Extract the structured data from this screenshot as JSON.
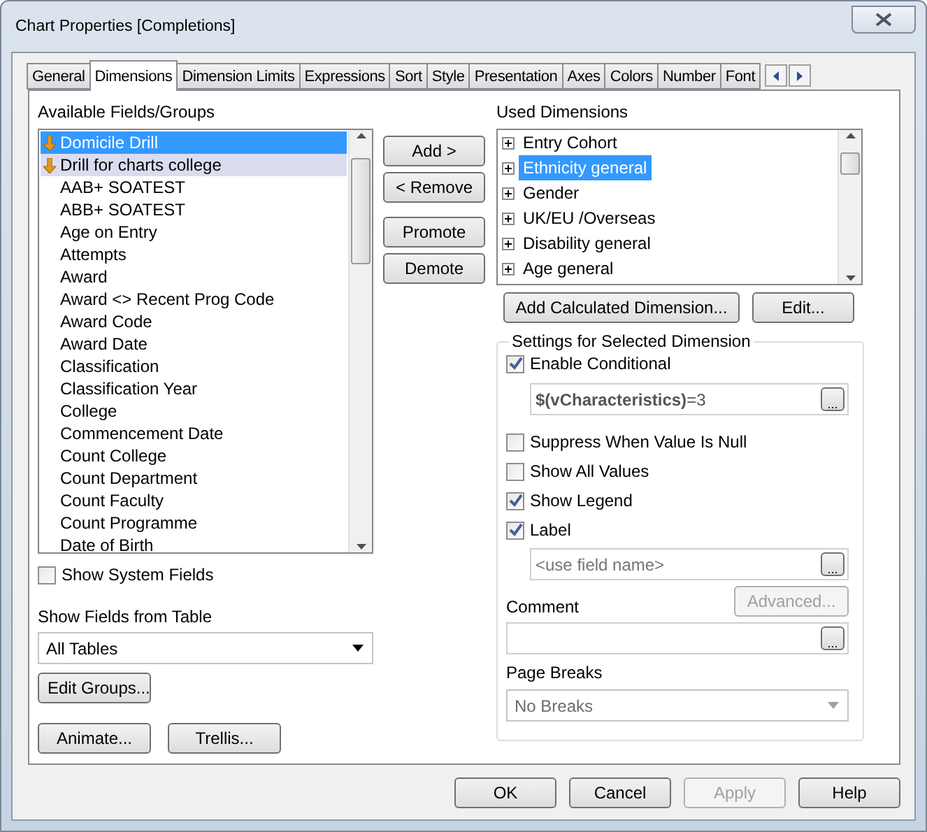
{
  "window": {
    "title": "Chart Properties [Completions]"
  },
  "tabs": [
    {
      "label": "General",
      "selected": false
    },
    {
      "label": "Dimensions",
      "selected": true
    },
    {
      "label": "Dimension Limits",
      "selected": false
    },
    {
      "label": "Expressions",
      "selected": false
    },
    {
      "label": "Sort",
      "selected": false
    },
    {
      "label": "Style",
      "selected": false
    },
    {
      "label": "Presentation",
      "selected": false
    },
    {
      "label": "Axes",
      "selected": false
    },
    {
      "label": "Colors",
      "selected": false
    },
    {
      "label": "Number",
      "selected": false
    },
    {
      "label": "Font",
      "selected": false
    }
  ],
  "available": {
    "label": "Available Fields/Groups",
    "items": [
      {
        "label": "Domicile Drill",
        "kind": "group",
        "selected": true,
        "highlighted": false
      },
      {
        "label": "Drill for charts college",
        "kind": "group",
        "selected": false,
        "highlighted": true
      },
      {
        "label": "AAB+ SOATEST",
        "kind": "field",
        "selected": false,
        "highlighted": false
      },
      {
        "label": "ABB+ SOATEST",
        "kind": "field",
        "selected": false,
        "highlighted": false
      },
      {
        "label": "Age on Entry",
        "kind": "field",
        "selected": false,
        "highlighted": false
      },
      {
        "label": "Attempts",
        "kind": "field",
        "selected": false,
        "highlighted": false
      },
      {
        "label": "Award",
        "kind": "field",
        "selected": false,
        "highlighted": false
      },
      {
        "label": "Award <> Recent Prog Code",
        "kind": "field",
        "selected": false,
        "highlighted": false
      },
      {
        "label": "Award Code",
        "kind": "field",
        "selected": false,
        "highlighted": false
      },
      {
        "label": "Award Date",
        "kind": "field",
        "selected": false,
        "highlighted": false
      },
      {
        "label": "Classification",
        "kind": "field",
        "selected": false,
        "highlighted": false
      },
      {
        "label": "Classification Year",
        "kind": "field",
        "selected": false,
        "highlighted": false
      },
      {
        "label": "College",
        "kind": "field",
        "selected": false,
        "highlighted": false
      },
      {
        "label": "Commencement Date",
        "kind": "field",
        "selected": false,
        "highlighted": false
      },
      {
        "label": "Count College",
        "kind": "field",
        "selected": false,
        "highlighted": false
      },
      {
        "label": "Count Department",
        "kind": "field",
        "selected": false,
        "highlighted": false
      },
      {
        "label": "Count Faculty",
        "kind": "field",
        "selected": false,
        "highlighted": false
      },
      {
        "label": "Count Programme",
        "kind": "field",
        "selected": false,
        "highlighted": false
      },
      {
        "label": "Date of Birth",
        "kind": "field",
        "selected": false,
        "highlighted": false
      }
    ],
    "show_system_fields": {
      "label": "Show System Fields",
      "checked": false
    },
    "table_label": "Show Fields from Table",
    "table_select": "All Tables",
    "buttons": [
      {
        "label": "Edit Groups..."
      }
    ],
    "bottom_buttons": [
      {
        "label": "Animate..."
      },
      {
        "label": "Trellis..."
      }
    ]
  },
  "move_buttons": [
    {
      "label": "Add >"
    },
    {
      "label": "< Remove"
    },
    {
      "label": "Promote"
    },
    {
      "label": "Demote"
    }
  ],
  "used": {
    "label": "Used Dimensions",
    "items": [
      {
        "label": "Entry Cohort",
        "selected": false,
        "expanded": false
      },
      {
        "label": "Ethnicity general",
        "selected": true,
        "expanded": false
      },
      {
        "label": "Gender",
        "selected": false,
        "expanded": false
      },
      {
        "label": "UK/EU /Overseas",
        "selected": false,
        "expanded": false
      },
      {
        "label": "Disability general",
        "selected": false,
        "expanded": false
      },
      {
        "label": "Age general",
        "selected": false,
        "expanded": false
      }
    ],
    "buttons": [
      {
        "label": "Add Calculated Dimension..."
      },
      {
        "label": "Edit..."
      }
    ]
  },
  "settings": {
    "title": "Settings for Selected Dimension",
    "enable_conditional": {
      "label": "Enable Conditional",
      "checked": true
    },
    "condition": {
      "value": "**$(vCharacteristics)**=3",
      "button": "..."
    },
    "options": [
      {
        "label": "Suppress When Value Is Null",
        "checked": false
      },
      {
        "label": "Show All Values",
        "checked": false
      },
      {
        "label": "Show Legend",
        "checked": true
      }
    ],
    "label_option": {
      "label": "Label",
      "checked": true
    },
    "label_field": {
      "placeholder": "<use field name>",
      "button": "..."
    },
    "comment_field": {
      "button": "..."
    },
    "advanced_button": {
      "label": "Advanced...",
      "disabled": true
    },
    "comment_label": "Comment",
    "page_breaks_label": "Page Breaks",
    "page_breaks_select": {
      "value": "No Breaks",
      "disabled": true
    }
  },
  "footer": [
    {
      "label": "OK",
      "disabled": false
    },
    {
      "label": "Cancel",
      "disabled": false
    },
    {
      "label": "Apply",
      "disabled": true
    },
    {
      "label": "Help",
      "disabled": false
    }
  ]
}
